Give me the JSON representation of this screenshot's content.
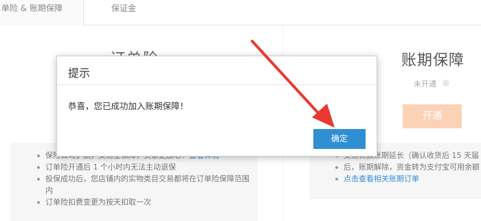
{
  "tabs": [
    {
      "label": "单险 & 账期保障"
    },
    {
      "label": "保证金"
    }
  ],
  "left_panel": {
    "title": "订单险",
    "items": [
      {
        "text": "保险公司护航，交易全保障，买家更放心！",
        "link": "查看详情"
      },
      {
        "text": "订单险开通后 1 个小时内无法主动退保"
      },
      {
        "text": "投保成功后，您店铺内的实物类目交易都将在订单险保障范围内"
      },
      {
        "text": "订单险扣费变更为按天扣取一次"
      }
    ]
  },
  "right_panel": {
    "title": "账期保障",
    "status": "未开通",
    "open_button": "开通",
    "items": [
      {
        "text": "交易货款账期延长（确认收货后 15 天届"
      },
      {
        "text": "后，账期解除，资金转为支付宝可用余额"
      },
      {
        "link": "点击查看相关账期订单"
      }
    ]
  },
  "modal": {
    "title": "提示",
    "message": "恭喜，您已成功加入账期保障！",
    "ok_label": "确定"
  },
  "colors": {
    "accent": "#2f8fd3",
    "arrow": "#e8392f",
    "open_button": "#fcd2b6",
    "link": "#3a8bd6"
  }
}
